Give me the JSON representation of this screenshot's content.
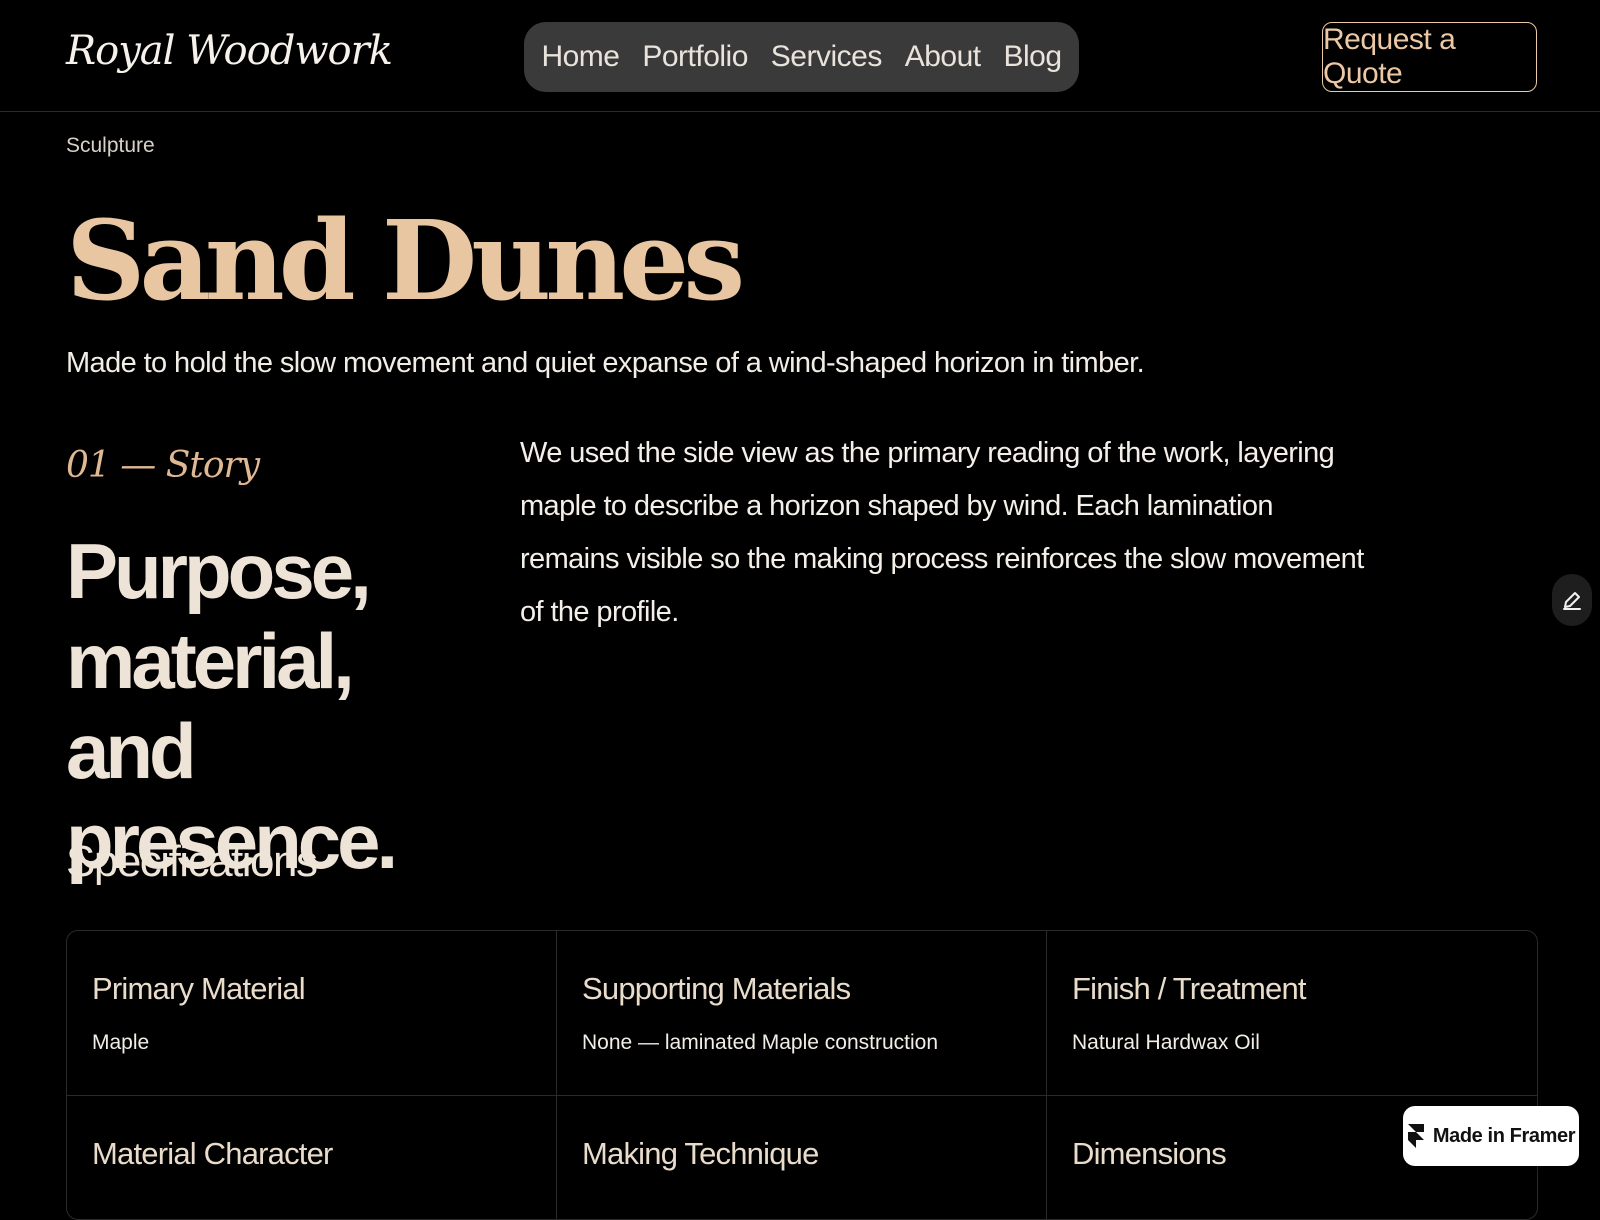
{
  "header": {
    "logo": "Royal Woodwork",
    "nav": [
      "Home",
      "Portfolio",
      "Services",
      "About",
      "Blog"
    ],
    "cta_label": "Request a Quote"
  },
  "project": {
    "category": "Sculpture",
    "title": "Sand Dunes",
    "tagline": "Made to hold the slow movement and quiet expanse of a wind-shaped horizon in timber."
  },
  "story_section": {
    "number_label": "01 — Story",
    "heading": "Purpose, material, and presence.",
    "body": "We used the side view as the primary reading of the work, layering maple to describe a horizon shaped by wind. Each lamination remains visible so the making process reinforces the slow movement of the profile."
  },
  "specifications": {
    "heading": "Specifications",
    "items": [
      {
        "label": "Primary Material",
        "value": "Maple"
      },
      {
        "label": "Supporting Materials",
        "value": "None — laminated Maple construction"
      },
      {
        "label": "Finish / Treatment",
        "value": "Natural Hardwax Oil"
      },
      {
        "label": "Material Character",
        "value": ""
      },
      {
        "label": "Making Technique",
        "value": ""
      },
      {
        "label": "Dimensions",
        "value": ""
      }
    ]
  },
  "badge": {
    "label": "Made in Framer",
    "icon": "framer-logo-icon"
  },
  "edit_button": {
    "icon": "pencil-icon"
  },
  "colors": {
    "background": "#000000",
    "accent": "#e9c6a2",
    "nav_background": "#3a3a3a"
  }
}
